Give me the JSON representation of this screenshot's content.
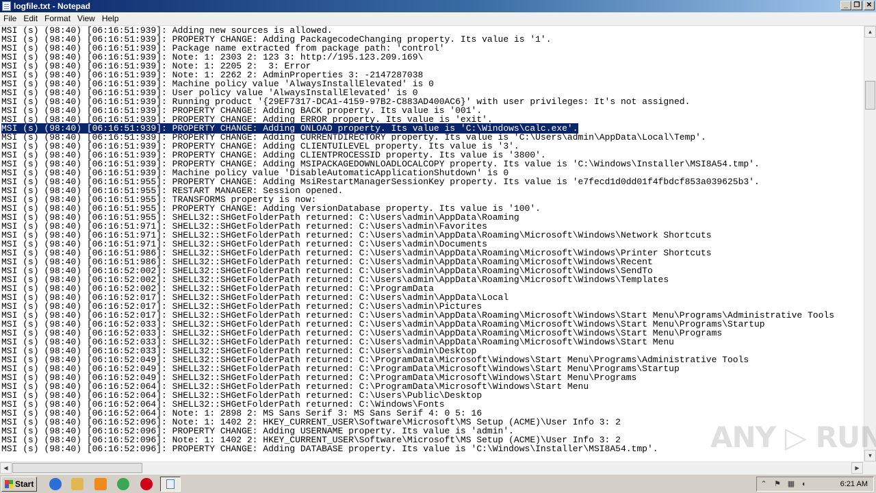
{
  "window": {
    "title": "logfile.txt - Notepad",
    "controls": {
      "minimize": "_",
      "maximize": "❐",
      "close": "✕"
    }
  },
  "menu": [
    {
      "label": "File"
    },
    {
      "label": "Edit"
    },
    {
      "label": "Format"
    },
    {
      "label": "View"
    },
    {
      "label": "Help"
    }
  ],
  "editor": {
    "selected_line_index": 11,
    "lines": [
      "MSI (s) (98:40) [06:16:51:939]: Adding new sources is allowed.",
      "MSI (s) (98:40) [06:16:51:939]: PROPERTY CHANGE: Adding PackagecodeChanging property. Its value is '1'.",
      "MSI (s) (98:40) [06:16:51:939]: Package name extracted from package path: 'control'",
      "MSI (s) (98:40) [06:16:51:939]: Note: 1: 2303 2: 123 3: http://195.123.209.169\\",
      "MSI (s) (98:40) [06:16:51:939]: Note: 1: 2205 2:  3: Error",
      "MSI (s) (98:40) [06:16:51:939]: Note: 1: 2262 2: AdminProperties 3: -2147287038",
      "MSI (s) (98:40) [06:16:51:939]: Machine policy value 'AlwaysInstallElevated' is 0",
      "MSI (s) (98:40) [06:16:51:939]: User policy value 'AlwaysInstallElevated' is 0",
      "MSI (s) (98:40) [06:16:51:939]: Running product '{29EF7317-DCA1-4159-97B2-C883AD400AC6}' with user privileges: It's not assigned.",
      "MSI (s) (98:40) [06:16:51:939]: PROPERTY CHANGE: Adding BACK property. Its value is '001'.",
      "MSI (s) (98:40) [06:16:51:939]: PROPERTY CHANGE: Adding ERROR property. Its value is 'exit'.",
      "MSI (s) (98:40) [06:16:51:939]: PROPERTY CHANGE: Adding ONLOAD property. Its value is 'C:\\Windows\\calc.exe'.",
      "MSI (s) (98:40) [06:16:51:939]: PROPERTY CHANGE: Adding CURRENTDIRECTORY property. Its value is 'C:\\Users\\admin\\AppData\\Local\\Temp'.",
      "MSI (s) (98:40) [06:16:51:939]: PROPERTY CHANGE: Adding CLIENTUILEVEL property. Its value is '3'.",
      "MSI (s) (98:40) [06:16:51:939]: PROPERTY CHANGE: Adding CLIENTPROCESSID property. Its value is '3800'.",
      "MSI (s) (98:40) [06:16:51:939]: PROPERTY CHANGE: Adding MSIPACKAGEDOWNLOADLOCALCOPY property. Its value is 'C:\\Windows\\Installer\\MSI8A54.tmp'.",
      "MSI (s) (98:40) [06:16:51:939]: Machine policy value 'DisableAutomaticApplicationShutdown' is 0",
      "MSI (s) (98:40) [06:16:51:955]: PROPERTY CHANGE: Adding MsiRestartManagerSessionKey property. Its value is 'e7fecd1d0dd01f4fbdcf853a039625b3'.",
      "MSI (s) (98:40) [06:16:51:955]: RESTART MANAGER: Session opened.",
      "MSI (s) (98:40) [06:16:51:955]: TRANSFORMS property is now:",
      "MSI (s) (98:40) [06:16:51:955]: PROPERTY CHANGE: Adding VersionDatabase property. Its value is '100'.",
      "MSI (s) (98:40) [06:16:51:955]: SHELL32::SHGetFolderPath returned: C:\\Users\\admin\\AppData\\Roaming",
      "MSI (s) (98:40) [06:16:51:971]: SHELL32::SHGetFolderPath returned: C:\\Users\\admin\\Favorites",
      "MSI (s) (98:40) [06:16:51:971]: SHELL32::SHGetFolderPath returned: C:\\Users\\admin\\AppData\\Roaming\\Microsoft\\Windows\\Network Shortcuts",
      "MSI (s) (98:40) [06:16:51:971]: SHELL32::SHGetFolderPath returned: C:\\Users\\admin\\Documents",
      "MSI (s) (98:40) [06:16:51:986]: SHELL32::SHGetFolderPath returned: C:\\Users\\admin\\AppData\\Roaming\\Microsoft\\Windows\\Printer Shortcuts",
      "MSI (s) (98:40) [06:16:51:986]: SHELL32::SHGetFolderPath returned: C:\\Users\\admin\\AppData\\Roaming\\Microsoft\\Windows\\Recent",
      "MSI (s) (98:40) [06:16:52:002]: SHELL32::SHGetFolderPath returned: C:\\Users\\admin\\AppData\\Roaming\\Microsoft\\Windows\\SendTo",
      "MSI (s) (98:40) [06:16:52:002]: SHELL32::SHGetFolderPath returned: C:\\Users\\admin\\AppData\\Roaming\\Microsoft\\Windows\\Templates",
      "MSI (s) (98:40) [06:16:52:002]: SHELL32::SHGetFolderPath returned: C:\\ProgramData",
      "MSI (s) (98:40) [06:16:52:017]: SHELL32::SHGetFolderPath returned: C:\\Users\\admin\\AppData\\Local",
      "MSI (s) (98:40) [06:16:52:017]: SHELL32::SHGetFolderPath returned: C:\\Users\\admin\\Pictures",
      "MSI (s) (98:40) [06:16:52:017]: SHELL32::SHGetFolderPath returned: C:\\Users\\admin\\AppData\\Roaming\\Microsoft\\Windows\\Start Menu\\Programs\\Administrative Tools",
      "MSI (s) (98:40) [06:16:52:033]: SHELL32::SHGetFolderPath returned: C:\\Users\\admin\\AppData\\Roaming\\Microsoft\\Windows\\Start Menu\\Programs\\Startup",
      "MSI (s) (98:40) [06:16:52:033]: SHELL32::SHGetFolderPath returned: C:\\Users\\admin\\AppData\\Roaming\\Microsoft\\Windows\\Start Menu\\Programs",
      "MSI (s) (98:40) [06:16:52:033]: SHELL32::SHGetFolderPath returned: C:\\Users\\admin\\AppData\\Roaming\\Microsoft\\Windows\\Start Menu",
      "MSI (s) (98:40) [06:16:52:033]: SHELL32::SHGetFolderPath returned: C:\\Users\\admin\\Desktop",
      "MSI (s) (98:40) [06:16:52:049]: SHELL32::SHGetFolderPath returned: C:\\ProgramData\\Microsoft\\Windows\\Start Menu\\Programs\\Administrative Tools",
      "MSI (s) (98:40) [06:16:52:049]: SHELL32::SHGetFolderPath returned: C:\\ProgramData\\Microsoft\\Windows\\Start Menu\\Programs\\Startup",
      "MSI (s) (98:40) [06:16:52:049]: SHELL32::SHGetFolderPath returned: C:\\ProgramData\\Microsoft\\Windows\\Start Menu\\Programs",
      "MSI (s) (98:40) [06:16:52:064]: SHELL32::SHGetFolderPath returned: C:\\ProgramData\\Microsoft\\Windows\\Start Menu",
      "MSI (s) (98:40) [06:16:52:064]: SHELL32::SHGetFolderPath returned: C:\\Users\\Public\\Desktop",
      "MSI (s) (98:40) [06:16:52:064]: SHELL32::SHGetFolderPath returned: C:\\Windows\\Fonts",
      "MSI (s) (98:40) [06:16:52:064]: Note: 1: 2898 2: MS Sans Serif 3: MS Sans Serif 4: 0 5: 16",
      "MSI (s) (98:40) [06:16:52:096]: Note: 1: 1402 2: HKEY_CURRENT_USER\\Software\\Microsoft\\MS Setup (ACME)\\User Info 3: 2",
      "MSI (s) (98:40) [06:16:52:096]: PROPERTY CHANGE: Adding USERNAME property. Its value is 'admin'.",
      "MSI (s) (98:40) [06:16:52:096]: Note: 1: 1402 2: HKEY_CURRENT_USER\\Software\\Microsoft\\MS Setup (ACME)\\User Info 3: 2",
      "MSI (s) (98:40) [06:16:52:096]: PROPERTY CHANGE: Adding DATABASE property. Its value is 'C:\\Windows\\Installer\\MSI8A54.tmp'."
    ]
  },
  "scrollbars": {
    "up_arrow": "▲",
    "down_arrow": "▼",
    "left_arrow": "◀",
    "right_arrow": "▶"
  },
  "taskbar": {
    "start_label": "Start",
    "quick_launch": [
      {
        "name": "ie-icon",
        "color": "#2b6fd6"
      },
      {
        "name": "explorer-icon",
        "color": "#e2b650"
      },
      {
        "name": "media-player-icon",
        "color": "#f08a1c"
      },
      {
        "name": "chrome-icon",
        "color": "#3aa757"
      },
      {
        "name": "opera-icon",
        "color": "#d0021b"
      }
    ],
    "tray": {
      "expand_arrow": "⌃",
      "time": "6:21 AM"
    }
  },
  "watermark": {
    "text": "ANY ▷ RUN"
  }
}
